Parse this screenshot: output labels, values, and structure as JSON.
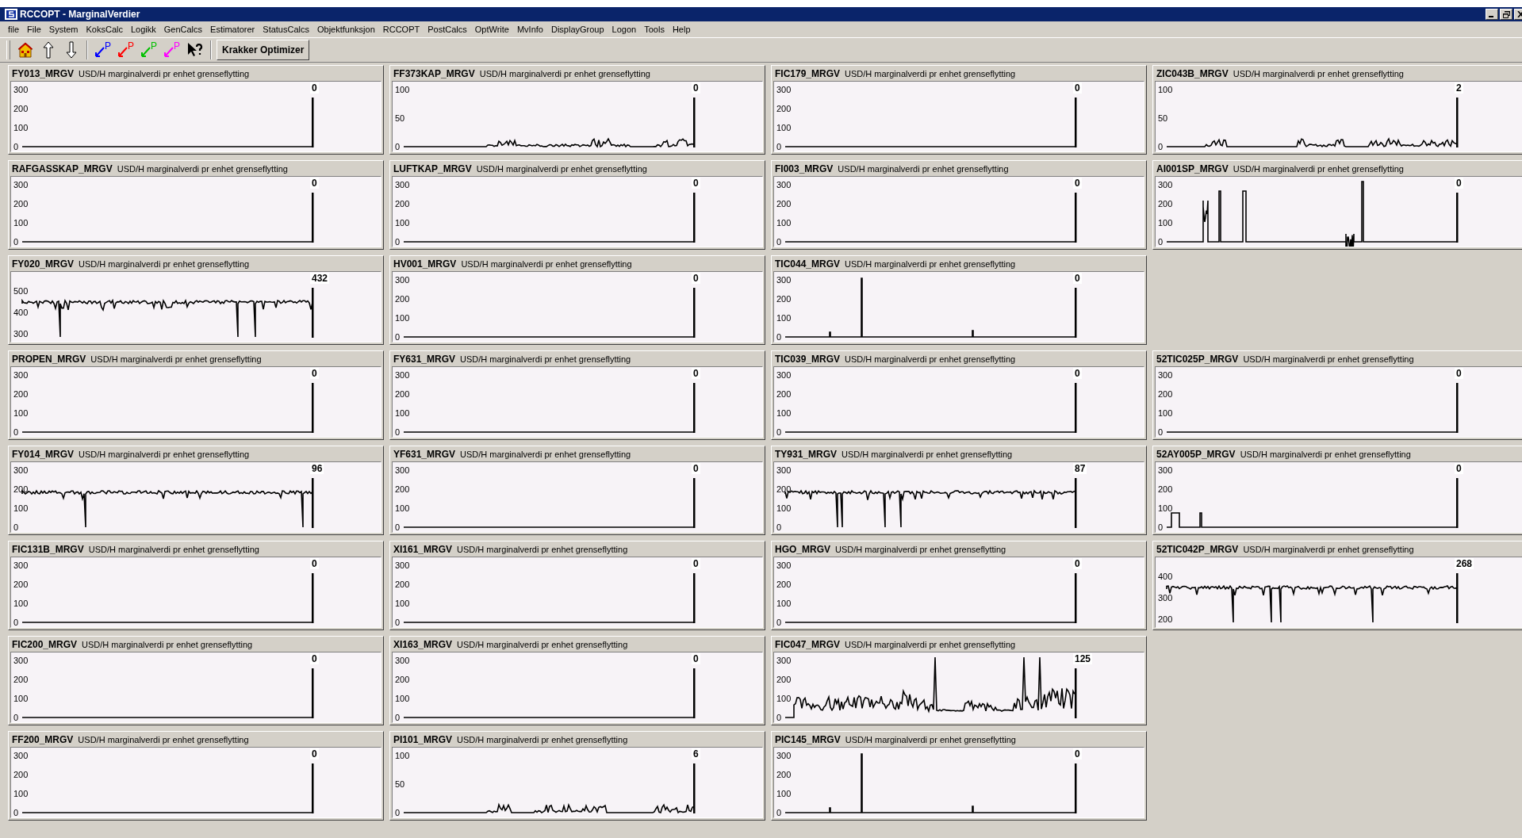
{
  "window": {
    "title": "RCCOPT - MarginalVerdier"
  },
  "menu": [
    "file",
    "File",
    "System",
    "KoksCalc",
    "Logikk",
    "GenCalcs",
    "Estimatorer",
    "StatusCalcs",
    "Objektfunksjon",
    "RCCOPT",
    "PostCalcs",
    "OptWrite",
    "MvInfo",
    "DisplayGroup",
    "Logon",
    "Tools",
    "Help"
  ],
  "toolbar": [
    {
      "kind": "home"
    },
    {
      "kind": "up"
    },
    {
      "kind": "down"
    },
    {
      "kind": "p-arrow",
      "label": "P",
      "color": "#0000ff"
    },
    {
      "kind": "p-arrow",
      "label": "P",
      "color": "#ff0000"
    },
    {
      "kind": "p-arrow",
      "label": "P",
      "color": "#00c000"
    },
    {
      "kind": "p-arrow",
      "label": "P",
      "color": "#ff00ff"
    },
    {
      "kind": "help"
    },
    {
      "kind": "button",
      "label": "Krakker Optimizer"
    }
  ],
  "rows": [
    {
      "panels": [
        {
          "tag": "FY013_MRGV",
          "description": "USD/H marginalverdi pr enhet grenseflytting",
          "yticks": [
            "300",
            "200",
            "100",
            "0"
          ],
          "value": "0",
          "kind": "flat"
        },
        {
          "tag": "FF373KAP_MRGV",
          "description": "USD/H marginalverdi pr enhet grenseflytting",
          "yticks": [
            "100",
            "50",
            "0"
          ],
          "value": "0",
          "kind": "ripple"
        },
        {
          "tag": "FIC179_MRGV",
          "description": "USD/H marginalverdi pr enhet grenseflytting",
          "yticks": [
            "300",
            "200",
            "100",
            "0"
          ],
          "value": "0",
          "kind": "flat"
        },
        {
          "tag": "ZIC043B_MRGV",
          "description": "USD/H marginalverdi pr enhet grenseflytting",
          "yticks": [
            "100",
            "50",
            "0"
          ],
          "value": "2",
          "kind": "ripple"
        }
      ]
    },
    {
      "panels": [
        {
          "tag": "RAFGASSKAP_MRGV",
          "description": "USD/H marginalverdi pr enhet grenseflytting",
          "yticks": [
            "300",
            "200",
            "100",
            "0"
          ],
          "value": "0",
          "kind": "flat"
        },
        {
          "tag": "LUFTKAP_MRGV",
          "description": "USD/H marginalverdi pr enhet grenseflytting",
          "yticks": [
            "300",
            "200",
            "100",
            "0"
          ],
          "value": "0",
          "kind": "flat"
        },
        {
          "tag": "FI003_MRGV",
          "description": "USD/H marginalverdi pr enhet grenseflytting",
          "yticks": [
            "300",
            "200",
            "100",
            "0"
          ],
          "value": "0",
          "kind": "flat"
        },
        {
          "tag": "AI001SP_MRGV",
          "description": "USD/H marginalverdi pr enhet grenseflytting",
          "yticks": [
            "300",
            "200",
            "100",
            "0"
          ],
          "value": "0",
          "kind": "blocks"
        }
      ]
    },
    {
      "panels": [
        {
          "tag": "FY020_MRGV",
          "description": "USD/H marginalverdi pr enhet grenseflytting",
          "yticks": [
            "500",
            "400",
            "300"
          ],
          "value": "432",
          "kind": "band"
        },
        {
          "tag": "HV001_MRGV",
          "description": "USD/H marginalverdi pr enhet grenseflytting",
          "yticks": [
            "300",
            "200",
            "100",
            "0"
          ],
          "value": "0",
          "kind": "flat"
        },
        {
          "tag": "TIC044_MRGV",
          "description": "USD/H marginalverdi pr enhet grenseflytting",
          "yticks": [
            "300",
            "200",
            "100",
            "0"
          ],
          "value": "0",
          "kind": "spike"
        }
      ]
    },
    {
      "panels": [
        {
          "tag": "PROPEN_MRGV",
          "description": "USD/H marginalverdi pr enhet grenseflytting",
          "yticks": [
            "300",
            "200",
            "100",
            "0"
          ],
          "value": "0",
          "kind": "flat"
        },
        {
          "tag": "FY631_MRGV",
          "description": "USD/H marginalverdi pr enhet grenseflytting",
          "yticks": [
            "300",
            "200",
            "100",
            "0"
          ],
          "value": "0",
          "kind": "flat"
        },
        {
          "tag": "TIC039_MRGV",
          "description": "USD/H marginalverdi pr enhet grenseflytting",
          "yticks": [
            "300",
            "200",
            "100",
            "0"
          ],
          "value": "0",
          "kind": "flat"
        },
        {
          "tag": "52TIC025P_MRGV",
          "description": "USD/H marginalverdi pr enhet grenseflytting",
          "yticks": [
            "300",
            "200",
            "100",
            "0"
          ],
          "value": "0",
          "kind": "flat"
        }
      ]
    },
    {
      "panels": [
        {
          "tag": "FY014_MRGV",
          "description": "USD/H marginalverdi pr enhet grenseflytting",
          "yticks": [
            "300",
            "200",
            "100",
            "0"
          ],
          "value": "96",
          "kind": "band"
        },
        {
          "tag": "YF631_MRGV",
          "description": "USD/H marginalverdi pr enhet grenseflytting",
          "yticks": [
            "300",
            "200",
            "100",
            "0"
          ],
          "value": "0",
          "kind": "flat"
        },
        {
          "tag": "TY931_MRGV",
          "description": "USD/H marginalverdi pr enhet grenseflytting",
          "yticks": [
            "300",
            "200",
            "100",
            "0"
          ],
          "value": "87",
          "kind": "band"
        },
        {
          "tag": "52AY005P_MRGV",
          "description": "USD/H marginalverdi pr enhet grenseflytting",
          "yticks": [
            "300",
            "200",
            "100",
            "0"
          ],
          "value": "0",
          "kind": "step"
        }
      ]
    },
    {
      "panels": [
        {
          "tag": "FIC131B_MRGV",
          "description": "USD/H marginalverdi pr enhet grenseflytting",
          "yticks": [
            "300",
            "200",
            "100",
            "0"
          ],
          "value": "0",
          "kind": "flat"
        },
        {
          "tag": "XI161_MRGV",
          "description": "USD/H marginalverdi pr enhet grenseflytting",
          "yticks": [
            "300",
            "200",
            "100",
            "0"
          ],
          "value": "0",
          "kind": "flat"
        },
        {
          "tag": "HGO_MRGV",
          "description": "USD/H marginalverdi pr enhet grenseflytting",
          "yticks": [
            "300",
            "200",
            "100",
            "0"
          ],
          "value": "0",
          "kind": "flat"
        },
        {
          "tag": "52TIC042P_MRGV",
          "description": "USD/H marginalverdi pr enhet grenseflytting",
          "yticks": [
            "400",
            "300",
            "200"
          ],
          "value": "268",
          "kind": "band"
        }
      ]
    },
    {
      "panels": [
        {
          "tag": "FIC200_MRGV",
          "description": "USD/H marginalverdi pr enhet grenseflytting",
          "yticks": [
            "300",
            "200",
            "100",
            "0"
          ],
          "value": "0",
          "kind": "flat"
        },
        {
          "tag": "XI163_MRGV",
          "description": "USD/H marginalverdi pr enhet grenseflytting",
          "yticks": [
            "300",
            "200",
            "100",
            "0"
          ],
          "value": "0",
          "kind": "flat"
        },
        {
          "tag": "FIC047_MRGV",
          "description": "USD/H marginalverdi pr enhet grenseflytting",
          "yticks": [
            "300",
            "200",
            "100",
            "0"
          ],
          "value": "125",
          "kind": "noisy"
        }
      ]
    },
    {
      "panels": [
        {
          "tag": "FF200_MRGV",
          "description": "USD/H marginalverdi pr enhet grenseflytting",
          "yticks": [
            "300",
            "200",
            "100",
            "0"
          ],
          "value": "0",
          "kind": "flat"
        },
        {
          "tag": "PI101_MRGV",
          "description": "USD/H marginalverdi pr enhet grenseflytting",
          "yticks": [
            "100",
            "50",
            "0"
          ],
          "value": "6",
          "kind": "ripple"
        },
        {
          "tag": "PIC145_MRGV",
          "description": "USD/H marginalverdi pr enhet grenseflytting",
          "yticks": [
            "300",
            "200",
            "100",
            "0"
          ],
          "value": "0",
          "kind": "spike"
        }
      ]
    }
  ]
}
